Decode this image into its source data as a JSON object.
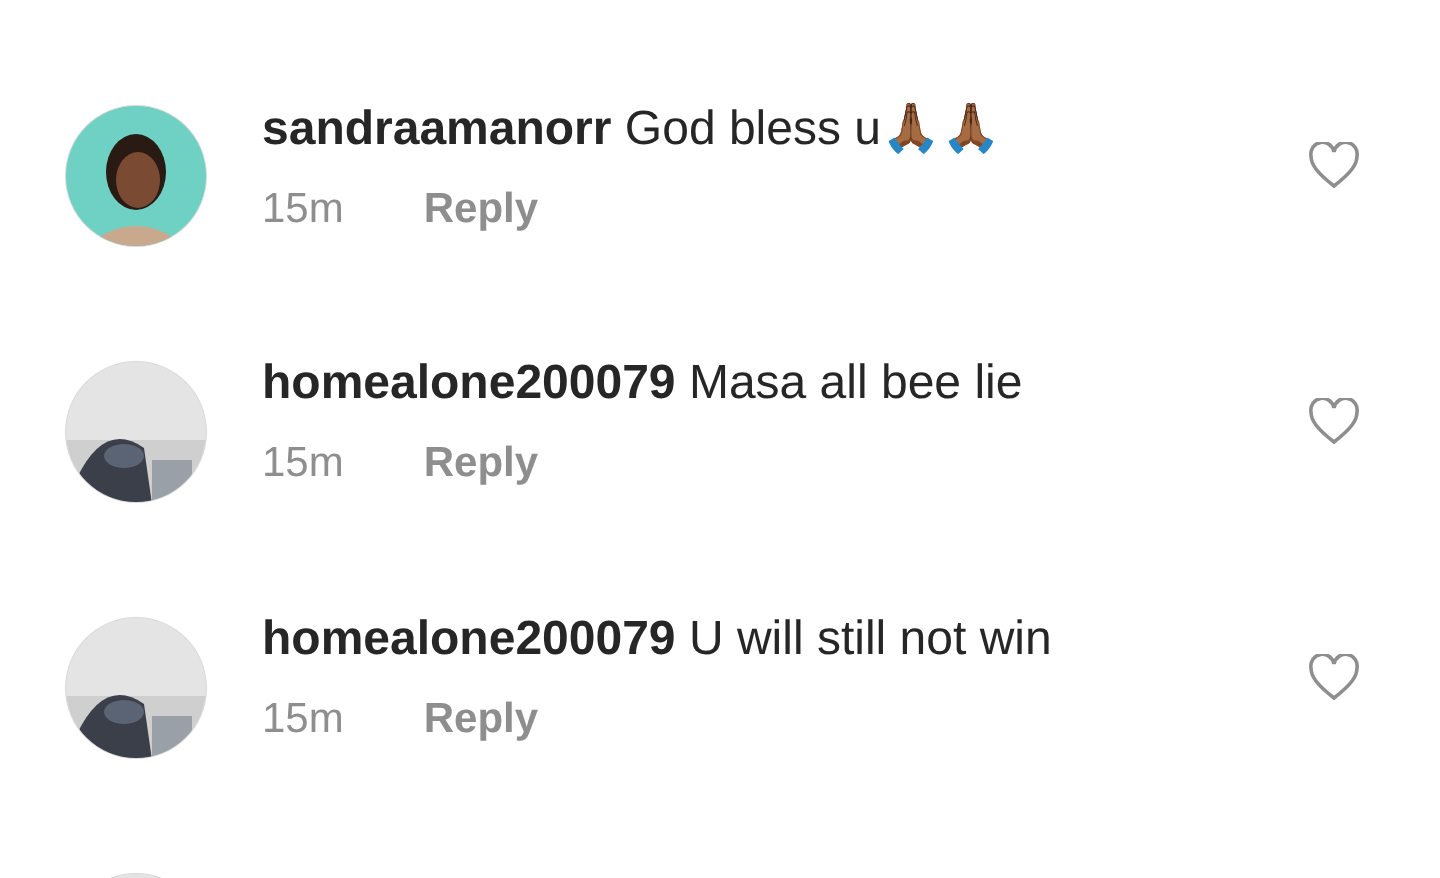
{
  "comments": [
    {
      "username": "sandraamanorr",
      "text": "God bless u🙏🏾🙏🏾",
      "time": "15m",
      "reply": "Reply",
      "liked": false
    },
    {
      "username": "homealone200079",
      "text": "Masa all bee lie",
      "time": "15m",
      "reply": "Reply",
      "liked": false
    },
    {
      "username": "homealone200079",
      "text": "U will still not win",
      "time": "15m",
      "reply": "Reply",
      "liked": false
    }
  ]
}
